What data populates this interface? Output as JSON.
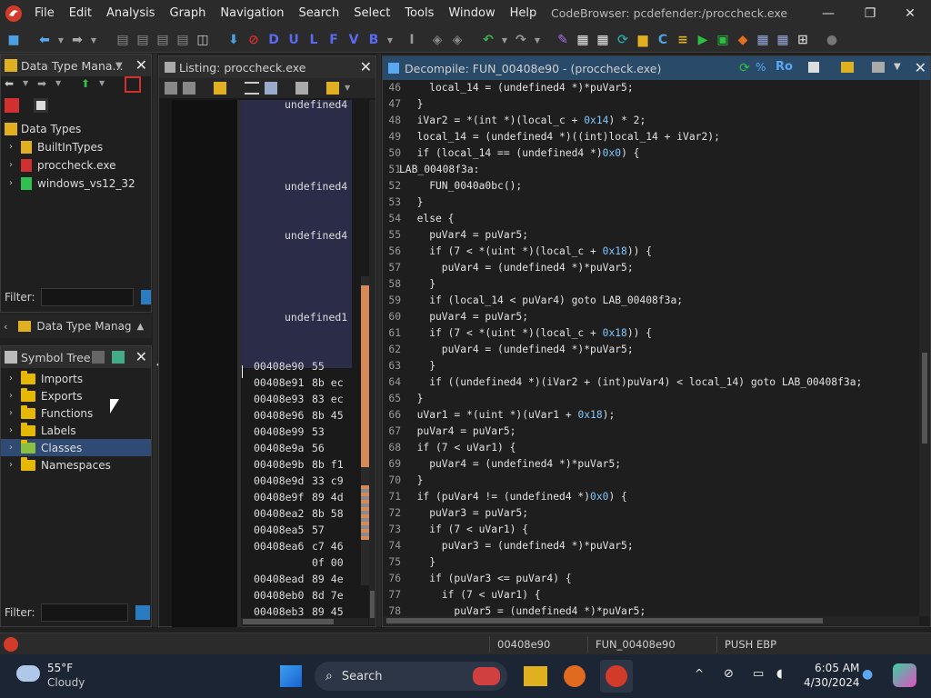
{
  "app": {
    "title": "CodeBrowser: pcdefender:/proccheck.exe"
  },
  "menu": [
    "File",
    "Edit",
    "Analysis",
    "Graph",
    "Navigation",
    "Search",
    "Select",
    "Tools",
    "Window",
    "Help"
  ],
  "window_controls": {
    "minimize": "—",
    "maximize": "❐",
    "close": "✕"
  },
  "datatype_panel": {
    "title": "Data Type Mana...",
    "root": "Data Types",
    "items": [
      "BuiltInTypes",
      "proccheck.exe",
      "windows_vs12_32"
    ],
    "filter_label": "Filter:",
    "filter_value": "",
    "collapsed_title": "Data Type Manag"
  },
  "symbol_tree": {
    "title": "Symbol Tree",
    "items": [
      "Imports",
      "Exports",
      "Functions",
      "Labels",
      "Classes",
      "Namespaces"
    ],
    "selected": "Classes",
    "filter_label": "Filter:",
    "filter_value": ""
  },
  "listing": {
    "title": "Listing:  proccheck.exe",
    "types": [
      "undefined4",
      "undefined4",
      "undefined4",
      "undefined1"
    ],
    "rows": [
      {
        "addr": "00408e90",
        "bytes": "55"
      },
      {
        "addr": "00408e91",
        "bytes": "8b ec"
      },
      {
        "addr": "00408e93",
        "bytes": "83 ec"
      },
      {
        "addr": "00408e96",
        "bytes": "8b 45"
      },
      {
        "addr": "00408e99",
        "bytes": "53"
      },
      {
        "addr": "00408e9a",
        "bytes": "56"
      },
      {
        "addr": "00408e9b",
        "bytes": "8b f1"
      },
      {
        "addr": "00408e9d",
        "bytes": "33 c9"
      },
      {
        "addr": "00408e9f",
        "bytes": "89 4d"
      },
      {
        "addr": "00408ea2",
        "bytes": "8b 58"
      },
      {
        "addr": "00408ea5",
        "bytes": "57"
      },
      {
        "addr": "00408ea6",
        "bytes": "c7 46"
      },
      {
        "addr": "",
        "bytes": "0f 00"
      },
      {
        "addr": "00408ead",
        "bytes": "89 4e"
      },
      {
        "addr": "00408eb0",
        "bytes": "8d 7e"
      },
      {
        "addr": "00408eb3",
        "bytes": "89 45"
      }
    ]
  },
  "decompile": {
    "title": "Decompile: FUN_00408e90 -  (proccheck.exe)",
    "ro_label": "Ro",
    "lines": [
      {
        "n": "46",
        "t": "    local_14 = (undefined4 *)*puVar5;"
      },
      {
        "n": "47",
        "t": "  }"
      },
      {
        "n": "48",
        "t": "  iVar2 = *(int *)(local_c + 0x14) * 2;"
      },
      {
        "n": "49",
        "t": "  local_14 = (undefined4 *)((int)local_14 + iVar2);"
      },
      {
        "n": "50",
        "t": "  if (local_14 == (undefined4 *)0x0) {"
      },
      {
        "n": "51",
        "t": "LAB_00408f3a:"
      },
      {
        "n": "52",
        "t": "    FUN_0040a0bc();"
      },
      {
        "n": "53",
        "t": "  }"
      },
      {
        "n": "54",
        "t": "  else {"
      },
      {
        "n": "55",
        "t": "    puVar4 = puVar5;"
      },
      {
        "n": "56",
        "t": "    if (7 < *(uint *)(local_c + 0x18)) {"
      },
      {
        "n": "57",
        "t": "      puVar4 = (undefined4 *)*puVar5;"
      },
      {
        "n": "58",
        "t": "    }"
      },
      {
        "n": "59",
        "t": "    if (local_14 < puVar4) goto LAB_00408f3a;"
      },
      {
        "n": "60",
        "t": "    puVar4 = puVar5;"
      },
      {
        "n": "61",
        "t": "    if (7 < *(uint *)(local_c + 0x18)) {"
      },
      {
        "n": "62",
        "t": "      puVar4 = (undefined4 *)*puVar5;"
      },
      {
        "n": "63",
        "t": "    }"
      },
      {
        "n": "64",
        "t": "    if ((undefined4 *)(iVar2 + (int)puVar4) < local_14) goto LAB_00408f3a;"
      },
      {
        "n": "65",
        "t": "  }"
      },
      {
        "n": "66",
        "t": "  uVar1 = *(uint *)(uVar1 + 0x18);"
      },
      {
        "n": "67",
        "t": "  puVar4 = puVar5;"
      },
      {
        "n": "68",
        "t": "  if (7 < uVar1) {"
      },
      {
        "n": "69",
        "t": "    puVar4 = (undefined4 *)*puVar5;"
      },
      {
        "n": "70",
        "t": "  }"
      },
      {
        "n": "71",
        "t": "  if (puVar4 != (undefined4 *)0x0) {"
      },
      {
        "n": "72",
        "t": "    puVar3 = puVar5;"
      },
      {
        "n": "73",
        "t": "    if (7 < uVar1) {"
      },
      {
        "n": "74",
        "t": "      puVar3 = (undefined4 *)*puVar5;"
      },
      {
        "n": "75",
        "t": "    }"
      },
      {
        "n": "76",
        "t": "    if (puVar3 <= puVar4) {"
      },
      {
        "n": "77",
        "t": "      if (7 < uVar1) {"
      },
      {
        "n": "78",
        "t": "        puVar5 = (undefined4 *)*puVar5;"
      }
    ]
  },
  "status": {
    "address": "00408e90",
    "function": "FUN_00408e90",
    "instruction": "PUSH EBP"
  },
  "taskbar": {
    "weather_temp": "55°F",
    "weather_desc": "Cloudy",
    "search_placeholder": "Search",
    "time": "6:05 AM",
    "date": "4/30/2024"
  },
  "colors": {
    "accent": "#2a4a6a",
    "selection": "#2f4b74",
    "code_number": "#7fc7ff",
    "bg": "#1f1f1f"
  }
}
